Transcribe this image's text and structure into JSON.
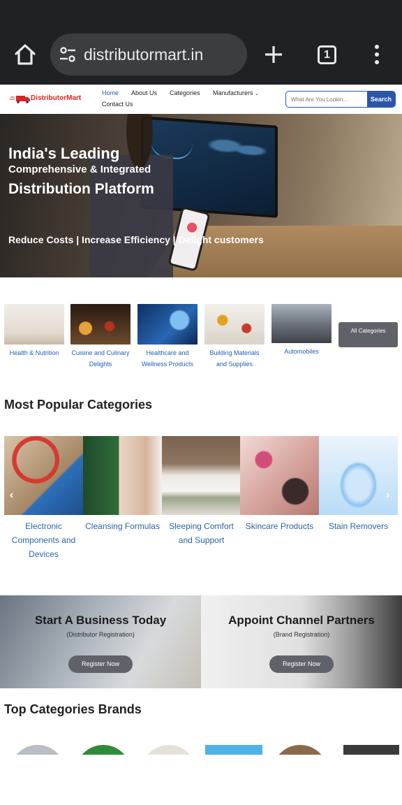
{
  "browser": {
    "url": "distributormart.in",
    "tab_count": "1"
  },
  "header": {
    "logo_text": "DistributorMart",
    "nav": [
      "Home",
      "About Us",
      "Categories",
      "Manufacturers",
      "Contact Us"
    ],
    "search_placeholder": "What Are You Lookin...",
    "search_button": "Search"
  },
  "hero": {
    "line1": "India's Leading",
    "line2": "Comprehensive & Integrated",
    "line3": "Distribution Platform",
    "line4": "Reduce Costs | Increase Efficiency | Delight customers"
  },
  "categories": {
    "items": [
      {
        "label": "Health & Nutrition",
        "color": "#e9e4de"
      },
      {
        "label": "Cuisine and Culinary Delights",
        "color": "#5a3b22"
      },
      {
        "label": "Healthcare and Wellness Products",
        "color": "#1e4d8a"
      },
      {
        "label": "Building Materials and Supplies",
        "color": "#d8cfc2"
      },
      {
        "label": "Automobiles",
        "color": "#7b7f86"
      }
    ],
    "all_label": "All Categories"
  },
  "popular": {
    "title": "Most Popular Categories",
    "items": [
      {
        "label": "Electronic Components and Devices"
      },
      {
        "label": "Cleansing Formulas"
      },
      {
        "label": "Sleeping Comfort and Support"
      },
      {
        "label": "Skincare Products"
      },
      {
        "label": "Stain Removers"
      }
    ]
  },
  "banners": [
    {
      "title": "Start A Business Today",
      "sub": "(Distributor Registration)",
      "button": "Register Now"
    },
    {
      "title": "Appoint Channel Partners",
      "sub": "(Brand Registration)",
      "button": "Register Now"
    }
  ],
  "brands": {
    "title": "Top Categories Brands"
  }
}
